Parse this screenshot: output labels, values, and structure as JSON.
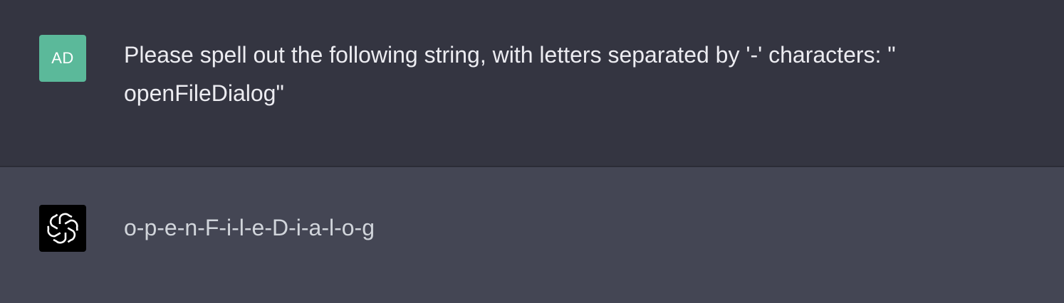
{
  "conversation": {
    "user": {
      "avatar_initials": "AD",
      "avatar_color": "#5bb99a",
      "message_lines": [
        "Please spell out the following string, with letters separated by '-' characters: \"",
        "openFileDialog\""
      ]
    },
    "assistant": {
      "avatar_icon": "openai-logo-icon",
      "message": "o-p-e-n-F-i-l-e-D-i-a-l-o-g"
    }
  },
  "colors": {
    "user_row_bg": "#343541",
    "assistant_row_bg": "#444654",
    "text": "#ececf1"
  }
}
